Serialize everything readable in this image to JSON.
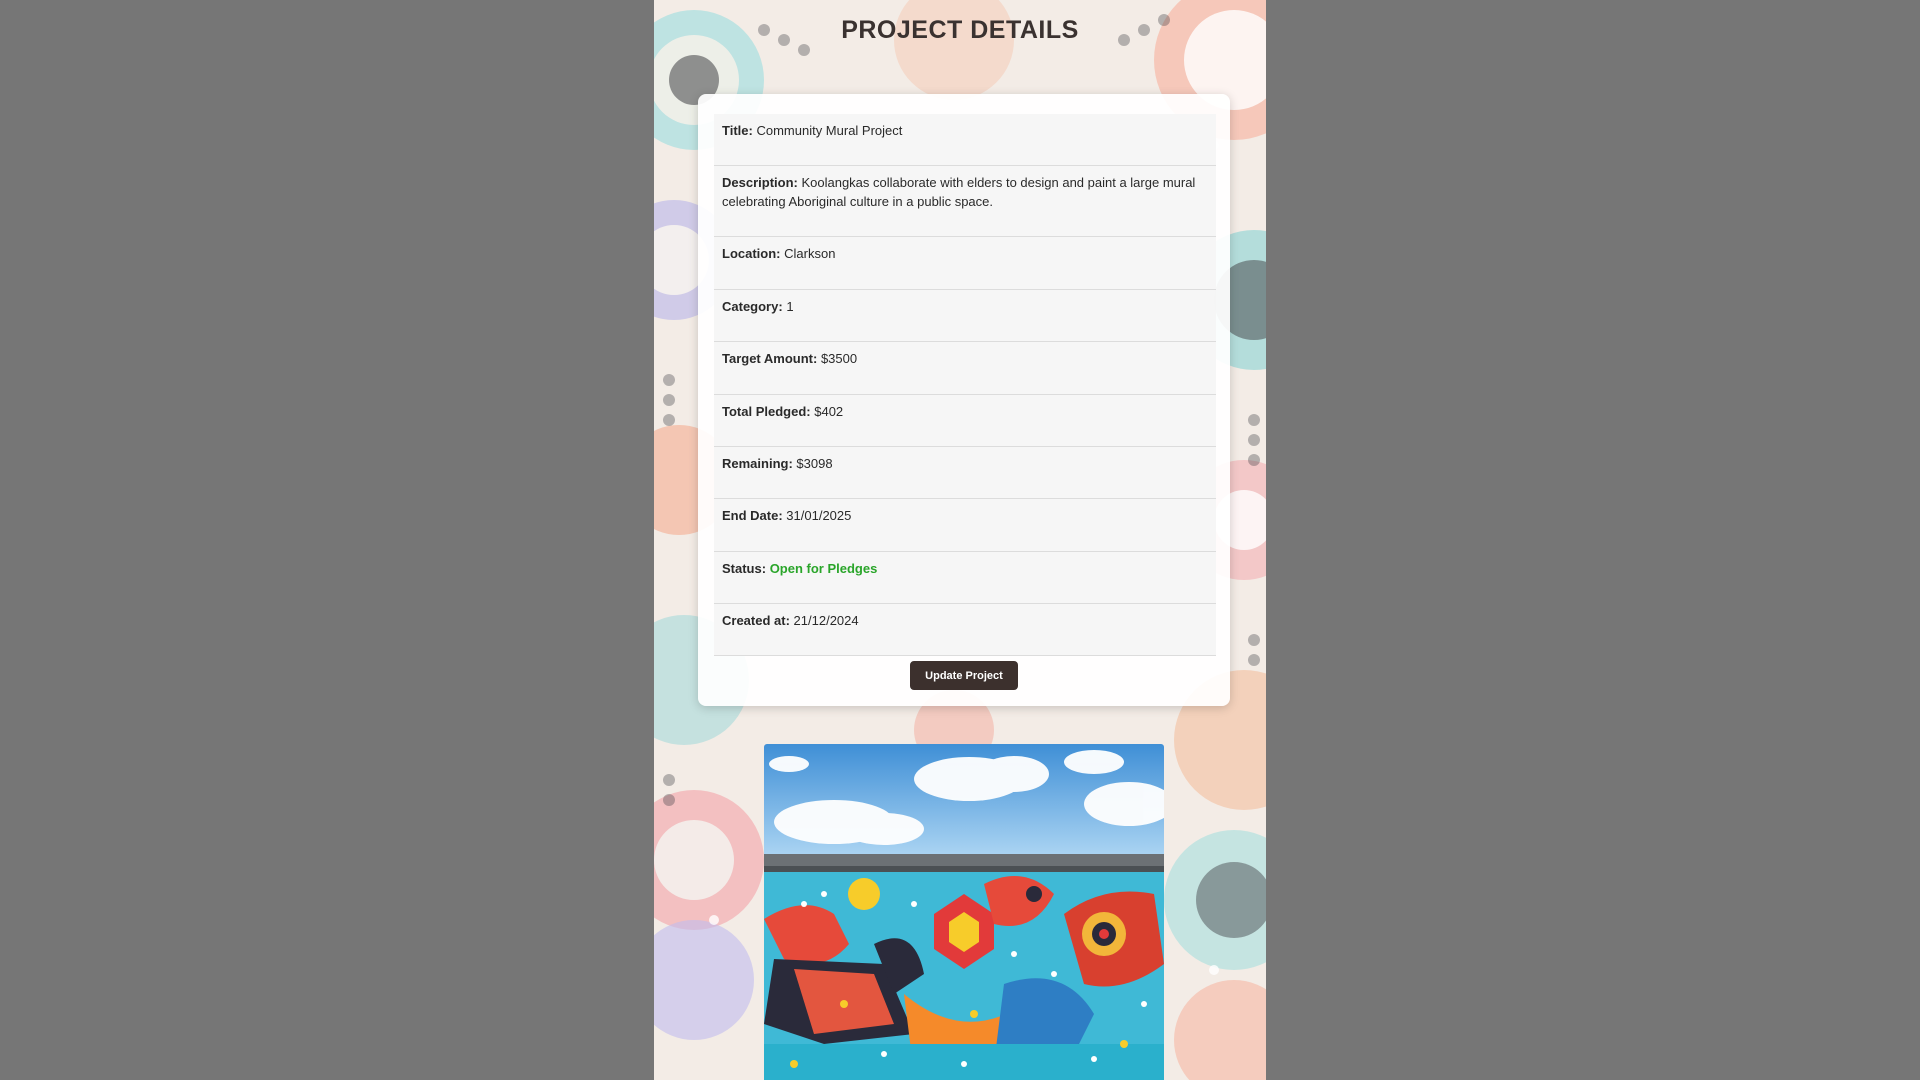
{
  "page": {
    "title": "PROJECT DETAILS"
  },
  "project": {
    "fields": [
      {
        "label": "Title:",
        "value": "Community Mural Project"
      },
      {
        "label": "Description:",
        "value": "Koolangkas collaborate with elders to design and paint a large mural celebrating Aboriginal culture in a public space."
      },
      {
        "label": "Location:",
        "value": "Clarkson"
      },
      {
        "label": "Category:",
        "value": "1"
      },
      {
        "label": "Target Amount:",
        "value": "$3500"
      },
      {
        "label": "Total Pledged:",
        "value": "$402"
      },
      {
        "label": "Remaining:",
        "value": "$3098"
      },
      {
        "label": "End Date:",
        "value": "31/01/2025"
      },
      {
        "label": "Status:",
        "value": "Open for Pledges"
      },
      {
        "label": "Created at:",
        "value": "21/12/2024"
      }
    ],
    "status_color": "#2aa52a",
    "update_button_label": "Update Project"
  },
  "colors": {
    "backdrop": "#767676",
    "button": "#3c302d",
    "title_text": "#3a3230"
  },
  "images": {
    "background": "aboriginal-dot-art-pattern",
    "project_photo": "community-mural-photo"
  }
}
